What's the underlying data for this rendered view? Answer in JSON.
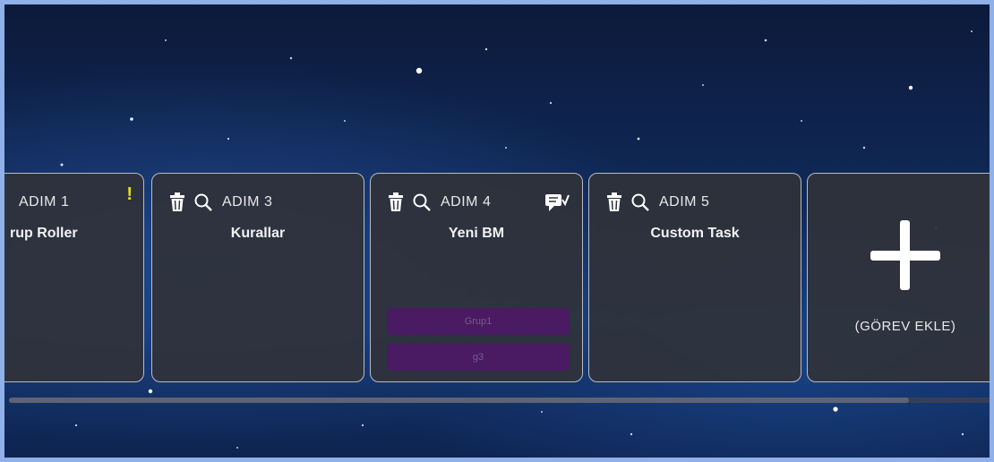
{
  "cards": [
    {
      "step": "ADIM 1",
      "title": "rup Roller",
      "warning": "!"
    },
    {
      "step": "ADIM 3",
      "title": "Kurallar"
    },
    {
      "step": "ADIM 4",
      "title": "Yeni BM",
      "tags": [
        "Grup1",
        "g3"
      ]
    },
    {
      "step": "ADIM 5",
      "title": "Custom Task"
    }
  ],
  "add_task": {
    "label": "(GÖREV EKLE)"
  },
  "icons": {
    "delete": "trash-icon",
    "inspect": "magnifier-icon",
    "comment": "comment-icon",
    "add": "plus-icon",
    "warning": "exclamation-icon"
  },
  "colors": {
    "card_bg": "#30323a",
    "card_border": "#b9bcc2",
    "tag_bg": "#4a1a63",
    "warning": "#e6e024"
  }
}
